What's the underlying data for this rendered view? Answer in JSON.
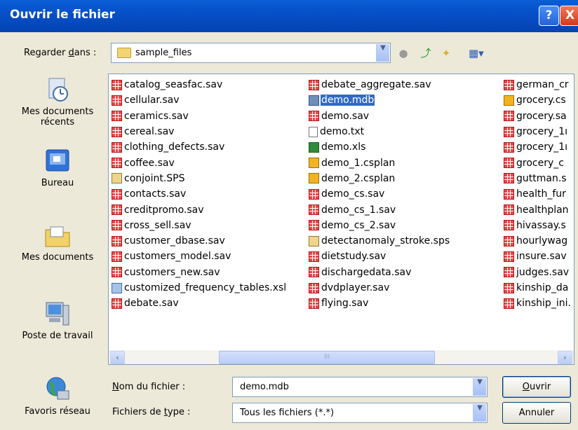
{
  "window": {
    "title": "Ouvrir le fichier",
    "help_btn": "?",
    "close_btn": "X"
  },
  "lookin": {
    "label_pre": "Regarder ",
    "label_u": "d",
    "label_post": "ans :",
    "value": "sample_files"
  },
  "places": [
    {
      "label": "Mes documents récents",
      "icon": "recent-documents-icon"
    },
    {
      "label": "Bureau",
      "icon": "desktop-icon"
    },
    {
      "label": "Mes documents",
      "icon": "my-documents-icon"
    },
    {
      "label": "Poste de travail",
      "icon": "my-computer-icon"
    },
    {
      "label": "Favoris réseau",
      "icon": "network-places-icon"
    }
  ],
  "files": {
    "col1": [
      {
        "name": "catalog_seasfac.sav",
        "type": "sav"
      },
      {
        "name": "cellular.sav",
        "type": "sav"
      },
      {
        "name": "ceramics.sav",
        "type": "sav"
      },
      {
        "name": "cereal.sav",
        "type": "sav"
      },
      {
        "name": "clothing_defects.sav",
        "type": "sav"
      },
      {
        "name": "coffee.sav",
        "type": "sav"
      },
      {
        "name": "conjoint.SPS",
        "type": "sps"
      },
      {
        "name": "contacts.sav",
        "type": "sav"
      },
      {
        "name": "creditpromo.sav",
        "type": "sav"
      },
      {
        "name": "cross_sell.sav",
        "type": "sav"
      },
      {
        "name": "customer_dbase.sav",
        "type": "sav"
      },
      {
        "name": "customers_model.sav",
        "type": "sav"
      },
      {
        "name": "customers_new.sav",
        "type": "sav"
      },
      {
        "name": "customized_frequency_tables.xsl",
        "type": "xsl"
      },
      {
        "name": "debate.sav",
        "type": "sav"
      }
    ],
    "col2": [
      {
        "name": "debate_aggregate.sav",
        "type": "sav"
      },
      {
        "name": "demo.mdb",
        "type": "mdb",
        "selected": true
      },
      {
        "name": "demo.sav",
        "type": "sav"
      },
      {
        "name": "demo.txt",
        "type": "txt"
      },
      {
        "name": "demo.xls",
        "type": "xls"
      },
      {
        "name": "demo_1.csplan",
        "type": "csplan"
      },
      {
        "name": "demo_2.csplan",
        "type": "csplan"
      },
      {
        "name": "demo_cs.sav",
        "type": "sav"
      },
      {
        "name": "demo_cs_1.sav",
        "type": "sav"
      },
      {
        "name": "demo_cs_2.sav",
        "type": "sav"
      },
      {
        "name": "detectanomaly_stroke.sps",
        "type": "sps"
      },
      {
        "name": "dietstudy.sav",
        "type": "sav"
      },
      {
        "name": "dischargedata.sav",
        "type": "sav"
      },
      {
        "name": "dvdplayer.sav",
        "type": "sav"
      },
      {
        "name": "flying.sav",
        "type": "sav"
      }
    ],
    "col3": [
      {
        "name": "german_cr",
        "type": "sav"
      },
      {
        "name": "grocery.cs",
        "type": "csplan"
      },
      {
        "name": "grocery.sa",
        "type": "sav"
      },
      {
        "name": "grocery_1ı",
        "type": "sav"
      },
      {
        "name": "grocery_1ı",
        "type": "sav"
      },
      {
        "name": "grocery_c",
        "type": "sav"
      },
      {
        "name": "guttman.s",
        "type": "sav"
      },
      {
        "name": "health_fur",
        "type": "sav"
      },
      {
        "name": "healthplan",
        "type": "sav"
      },
      {
        "name": "hivassay.s",
        "type": "sav"
      },
      {
        "name": "hourlywag",
        "type": "sav"
      },
      {
        "name": "insure.sav",
        "type": "sav"
      },
      {
        "name": "judges.sav",
        "type": "sav"
      },
      {
        "name": "kinship_da",
        "type": "sav"
      },
      {
        "name": "kinship_ini.",
        "type": "sav"
      }
    ]
  },
  "filename": {
    "label_pre": "",
    "label_u": "N",
    "label_post": "om du fichier :",
    "value": "demo.mdb"
  },
  "filetype": {
    "label_pre": "Fichiers de ",
    "label_u": "t",
    "label_post": "ype :",
    "value": "Tous les fichiers (*.*)"
  },
  "buttons": {
    "open_u": "O",
    "open_rest": "uvrir",
    "cancel": "Annuler"
  },
  "scroll": {
    "left": "‹",
    "right": "›",
    "grip": "III"
  },
  "colors": {
    "title_bar": "#0650c8",
    "selection": "#316ac5",
    "dialog_bg": "#ece9d8"
  }
}
